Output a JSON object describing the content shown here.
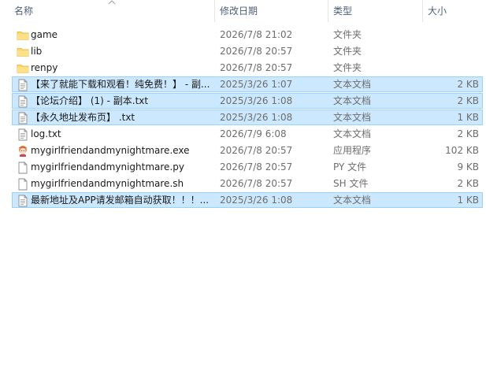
{
  "columns": {
    "name": "名称",
    "date": "修改日期",
    "type": "类型",
    "size": "大小"
  },
  "files": [
    {
      "name": "game",
      "date": "2026/7/8 21:02",
      "type": "文件夹",
      "size": "",
      "icon": "folder-icon",
      "selected": false
    },
    {
      "name": "lib",
      "date": "2026/7/8 20:57",
      "type": "文件夹",
      "size": "",
      "icon": "folder-icon",
      "selected": false
    },
    {
      "name": "renpy",
      "date": "2026/7/8 20:57",
      "type": "文件夹",
      "size": "",
      "icon": "folder-icon",
      "selected": false
    },
    {
      "name": "【来了就能下载和观看！纯免费！】 - 副...",
      "date": "2025/3/26 1:07",
      "type": "文本文档",
      "size": "2 KB",
      "icon": "text-document-icon",
      "selected": true
    },
    {
      "name": "【论坛介绍】 (1) - 副本.txt",
      "date": "2025/3/26 1:08",
      "type": "文本文档",
      "size": "2 KB",
      "icon": "text-document-icon",
      "selected": true
    },
    {
      "name": "【永久地址发布页】 .txt",
      "date": "2025/3/26 1:08",
      "type": "文本文档",
      "size": "1 KB",
      "icon": "text-document-icon",
      "selected": true
    },
    {
      "name": "log.txt",
      "date": "2026/7/9 6:08",
      "type": "文本文档",
      "size": "2 KB",
      "icon": "text-document-icon",
      "selected": false
    },
    {
      "name": "mygirlfriendandmynightmare.exe",
      "date": "2026/7/8 20:57",
      "type": "应用程序",
      "size": "102 KB",
      "icon": "app-character-icon",
      "selected": false
    },
    {
      "name": "mygirlfriendandmynightmare.py",
      "date": "2026/7/8 20:57",
      "type": "PY 文件",
      "size": "9 KB",
      "icon": "blank-file-icon",
      "selected": false
    },
    {
      "name": "mygirlfriendandmynightmare.sh",
      "date": "2026/7/8 20:57",
      "type": "SH 文件",
      "size": "2 KB",
      "icon": "blank-file-icon",
      "selected": false
    },
    {
      "name": "最新地址及APP请发邮箱自动获取！！！...",
      "date": "2025/3/26 1:08",
      "type": "文本文档",
      "size": "1 KB",
      "icon": "text-document-icon",
      "selected": true
    }
  ],
  "colors": {
    "selection_bg": "#cce8ff",
    "selection_border": "#99d1ff",
    "folder": "#ffd766",
    "header_text": "#4c607a"
  }
}
